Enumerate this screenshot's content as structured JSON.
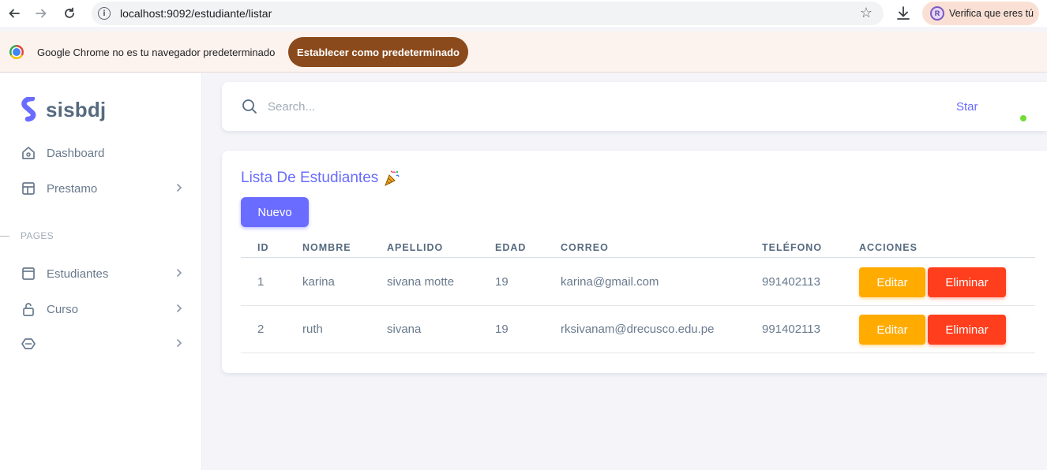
{
  "browser": {
    "url": "localhost:9092/estudiante/listar",
    "verify_label": "Verifica que eres tú",
    "avatar_letter": "R"
  },
  "infobar": {
    "message": "Google Chrome no es tu navegador predeterminado",
    "button_label": "Establecer como predeterminado"
  },
  "sidebar": {
    "brand": "sisbdj",
    "items": [
      {
        "label": "Dashboard",
        "icon": "home-icon"
      },
      {
        "label": "Prestamo",
        "icon": "layout-icon"
      }
    ],
    "section_label": "PAGES",
    "page_items": [
      {
        "label": "Estudiantes",
        "icon": "window-icon"
      },
      {
        "label": "Curso",
        "icon": "lock-icon"
      },
      {
        "label": "",
        "icon": "hexagon-icon"
      }
    ]
  },
  "search": {
    "placeholder": "Search...",
    "star_label": "Star"
  },
  "card": {
    "title": "Lista De Estudiantes",
    "new_button": "Nuevo"
  },
  "table": {
    "headers": [
      "ID",
      "NOMBRE",
      "APELLIDO",
      "EDAD",
      "CORREO",
      "TELÉFONO",
      "ACCIONES"
    ],
    "rows": [
      {
        "id": "1",
        "nombre": "karina",
        "apellido": "sivana motte",
        "edad": "19",
        "correo": "karina@gmail.com",
        "telefono": "991402113",
        "edit": "Editar",
        "delete": "Eliminar"
      },
      {
        "id": "2",
        "nombre": "ruth",
        "apellido": "sivana",
        "edad": "19",
        "correo": "rksivanam@drecusco.edu.pe",
        "telefono": "991402113",
        "edit": "Editar",
        "delete": "Eliminar"
      }
    ]
  },
  "colors": {
    "primary": "#696cff",
    "warning": "#ffab00",
    "danger": "#ff3e1d",
    "status_online": "#71dd37"
  }
}
